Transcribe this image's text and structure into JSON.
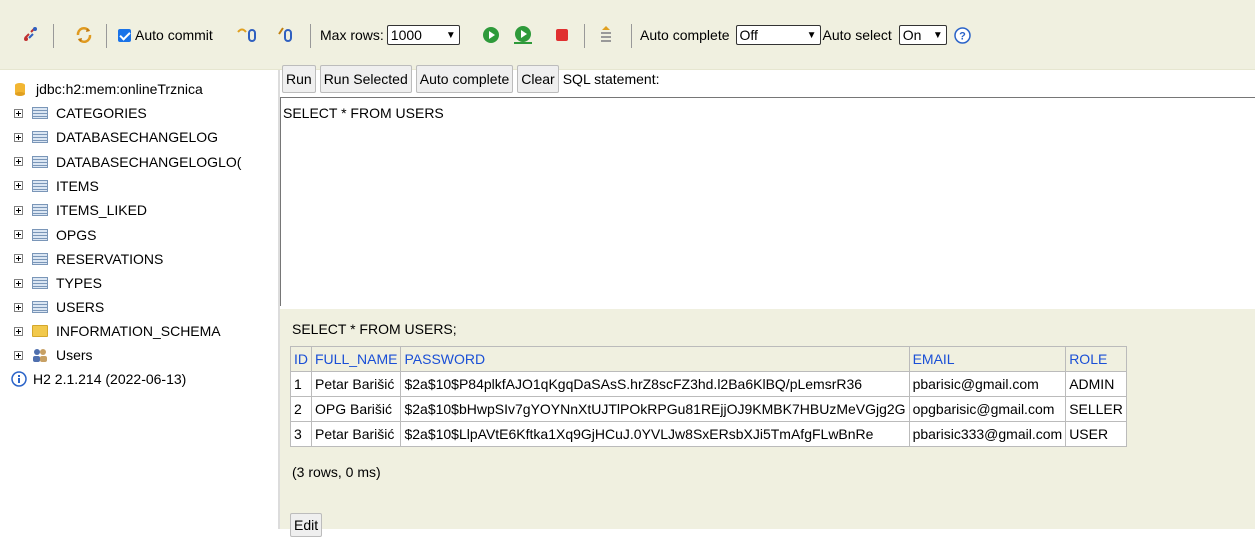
{
  "toolbar": {
    "auto_commit_label": "Auto commit",
    "max_rows_label": "Max rows:",
    "max_rows_value": "1000",
    "auto_complete_label": "Auto complete",
    "auto_complete_value": "Off",
    "auto_select_label": "Auto select",
    "auto_select_value": "On",
    "accent_color": "#1a73e8"
  },
  "sidebar": {
    "connection": "jdbc:h2:mem:onlineTrznica",
    "tables": [
      "CATEGORIES",
      "DATABASECHANGELOG",
      "DATABASECHANGELOGLO(",
      "ITEMS",
      "ITEMS_LIKED",
      "OPGS",
      "RESERVATIONS",
      "TYPES",
      "USERS"
    ],
    "schema": "INFORMATION_SCHEMA",
    "users": "Users",
    "version": "H2 2.1.214 (2022-06-13)"
  },
  "editor": {
    "buttons": [
      "Run",
      "Run Selected",
      "Auto complete",
      "Clear"
    ],
    "label": "SQL statement:",
    "sql": "SELECT * FROM USERS"
  },
  "results": {
    "query": "SELECT * FROM USERS;",
    "columns": [
      "ID",
      "FULL_NAME",
      "PASSWORD",
      "EMAIL",
      "ROLE"
    ],
    "rows": [
      [
        "1",
        "Petar Barišić",
        "$2a$10$P84plkfAJO1qKgqDaSAsS.hrZ8scFZ3hd.l2Ba6KlBQ/pLemsrR36",
        "pbarisic@gmail.com",
        "ADMIN"
      ],
      [
        "2",
        "OPG Barišić",
        "$2a$10$bHwpSIv7gYOYNnXtUJTlPOkRPGu81REjjOJ9KMBK7HBUzMeVGjg2G",
        "opgbarisic@gmail.com",
        "SELLER"
      ],
      [
        "3",
        "Petar Barišić",
        "$2a$10$LlpAVtE6Kftka1Xq9GjHCuJ.0YVLJw8SxERsbXJi5TmAfgFLwBnRe",
        "pbarisic333@gmail.com",
        "USER"
      ]
    ],
    "summary": "(3 rows, 0 ms)",
    "edit_label": "Edit",
    "header_color": "#1a4fd6"
  }
}
